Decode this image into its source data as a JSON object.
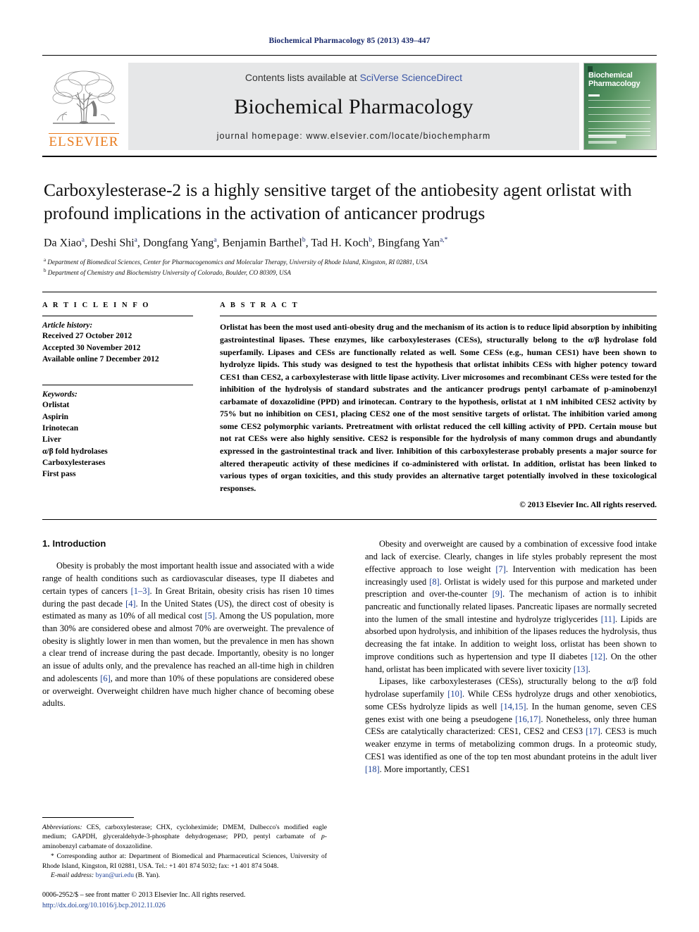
{
  "running_head": "Biochemical Pharmacology 85 (2013) 439–447",
  "banner": {
    "contents_prefix": "Contents lists available at ",
    "sciencedirect": "SciVerse ScienceDirect",
    "journal_name": "Biochemical Pharmacology",
    "homepage": "journal homepage: www.elsevier.com/locate/biochempharm",
    "publisher": "ELSEVIER",
    "cover_title_line1": "Biochemical",
    "cover_title_line2": "Pharmacology"
  },
  "article": {
    "title": "Carboxylesterase-2 is a highly sensitive target of the antiobesity agent orlistat with profound implications in the activation of anticancer prodrugs",
    "authors_html": "Da Xiao<sup>a</sup>, Deshi Shi<sup>a</sup>, Dongfang Yang<sup>a</sup>, Benjamin Barthel<sup>b</sup>, Tad H. Koch<sup>b</sup>, Bingfang Yan<sup>a,</sup><sup>*</sup>",
    "affiliation_a": "Department of Biomedical Sciences, Center for Pharmacogenomics and Molecular Therapy, University of Rhode Island, Kingston, RI 02881, USA",
    "affiliation_b": "Department of Chemistry and Biochemistry University of Colorado, Boulder, CO 80309, USA"
  },
  "article_info": {
    "heading": "A R T I C L E   I N F O",
    "history_label": "Article history:",
    "history": [
      "Received 27 October 2012",
      "Accepted 30 November 2012",
      "Available online 7 December 2012"
    ],
    "keywords_label": "Keywords:",
    "keywords": [
      "Orlistat",
      "Aspirin",
      "Irinotecan",
      "Liver",
      "α/β fold hydrolases",
      "Carboxylesterases",
      "First pass"
    ]
  },
  "abstract": {
    "heading": "A B S T R A C T",
    "text": "Orlistat has been the most used anti-obesity drug and the mechanism of its action is to reduce lipid absorption by inhibiting gastrointestinal lipases. These enzymes, like carboxylesterases (CESs), structurally belong to the α/β hydrolase fold superfamily. Lipases and CESs are functionally related as well. Some CESs (e.g., human CES1) have been shown to hydrolyze lipids. This study was designed to test the hypothesis that orlistat inhibits CESs with higher potency toward CES1 than CES2, a carboxylesterase with little lipase activity. Liver microsomes and recombinant CESs were tested for the inhibition of the hydrolysis of standard substrates and the anticancer prodrugs pentyl carbamate of p-aminobenzyl carbamate of doxazolidine (PPD) and irinotecan. Contrary to the hypothesis, orlistat at 1 nM inhibited CES2 activity by 75% but no inhibition on CES1, placing CES2 one of the most sensitive targets of orlistat. The inhibition varied among some CES2 polymorphic variants. Pretreatment with orlistat reduced the cell killing activity of PPD. Certain mouse but not rat CESs were also highly sensitive. CES2 is responsible for the hydrolysis of many common drugs and abundantly expressed in the gastrointestinal track and liver. Inhibition of this carboxylesterase probably presents a major source for altered therapeutic activity of these medicines if co-administered with orlistat. In addition, orlistat has been linked to various types of organ toxicities, and this study provides an alternative target potentially involved in these toxicological responses.",
    "copyright": "© 2013 Elsevier Inc. All rights reserved."
  },
  "body": {
    "section_heading": "1. Introduction",
    "left_paragraph_1_html": "Obesity is probably the most important health issue and associated with a wide range of health conditions such as cardiovascular diseases, type II diabetes and certain types of cancers <span class=\"ref\">[1–3]</span>. In Great Britain, obesity crisis has risen 10 times during the past decade <span class=\"ref\">[4]</span>. In the United States (US), the direct cost of obesity is estimated as many as 10% of all medical cost <span class=\"ref\">[5]</span>. Among the US population, more than 30% are considered obese and almost 70% are overweight. The prevalence of obesity is slightly lower in men than women, but the prevalence in men has shown a clear trend of increase during the past decade. Importantly, obesity is no longer an issue of adults only, and the prevalence has reached an all-time high in children and adolescents <span class=\"ref\">[6]</span>, and more than 10% of these populations are considered obese or overweight. Overweight children have much higher chance of becoming obese adults.",
    "right_paragraph_1_html": "Obesity and overweight are caused by a combination of excessive food intake and lack of exercise. Clearly, changes in life styles probably represent the most effective approach to lose weight <span class=\"ref\">[7]</span>. Intervention with medication has been increasingly used <span class=\"ref\">[8]</span>. Orlistat is widely used for this purpose and marketed under prescription and over-the-counter <span class=\"ref\">[9]</span>. The mechanism of action is to inhibit pancreatic and functionally related lipases. Pancreatic lipases are normally secreted into the lumen of the small intestine and hydrolyze triglycerides <span class=\"ref\">[11]</span>. Lipids are absorbed upon hydrolysis, and inhibition of the lipases reduces the hydrolysis, thus decreasing the fat intake. In addition to weight loss, orlistat has been shown to improve conditions such as hypertension and type II diabetes <span class=\"ref\">[12]</span>. On the other hand, orlistat has been implicated with severe liver toxicity <span class=\"ref\">[13]</span>.",
    "right_paragraph_2_html": "Lipases, like carboxylesterases (CESs), structurally belong to the α/β fold hydrolase superfamily <span class=\"ref\">[10]</span>. While CESs hydrolyze drugs and other xenobiotics, some CESs hydrolyze lipids as well <span class=\"ref\">[14,15]</span>. In the human genome, seven CES genes exist with one being a pseudogene <span class=\"ref\">[16,17]</span>. Nonetheless, only three human CESs are catalytically characterized: CES1, CES2 and CES3 <span class=\"ref\">[17]</span>. CES3 is much weaker enzyme in terms of metabolizing common drugs. In a proteomic study, CES1 was identified as one of the top ten most abundant proteins in the adult liver <span class=\"ref\">[18]</span>. More importantly, CES1"
  },
  "footnotes": {
    "abbreviations_html": "<i>Abbreviations:</i> CES, carboxylesterase; CHX, cycloheximide; DMEM, Dulbecco's modified eagle medium; GAPDH, glyceraldehyde-3-phosphate dehydrogenase; PPD, pentyl carbamate of <i>p</i>-aminobenzyl carbamate of doxazolidine.",
    "corresponding_html": "* Corresponding author at: Department of Biomedical and Pharmaceutical Sciences, University of Rhode Island, Kingston, RI 02881, USA. Tel.: +1 401 874 5032; fax: +1 401 874 5048.",
    "email_html": "<i>E-mail address:</i> <span class=\"lnk\">byan@uri.edu</span> (B. Yan).",
    "issn_html": "0006-2952/$ – see front matter © 2013 Elsevier Inc. All rights reserved.",
    "doi": "http://dx.doi.org/10.1016/j.bcp.2012.11.026"
  }
}
